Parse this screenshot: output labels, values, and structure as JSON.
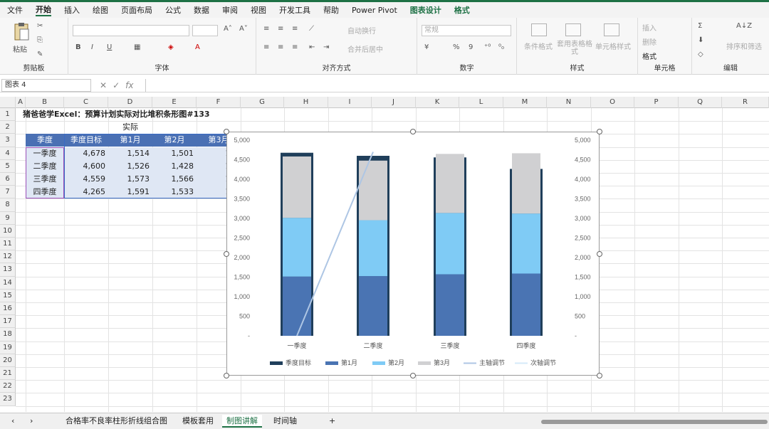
{
  "menu": [
    "文件",
    "开始",
    "插入",
    "绘图",
    "页面布局",
    "公式",
    "数据",
    "审阅",
    "视图",
    "开发工具",
    "帮助",
    "Power Pivot",
    "图表设计",
    "格式"
  ],
  "ribbon": {
    "paste": "粘贴",
    "clipboard": "剪贴板",
    "font": "字体",
    "alignment": "对齐方式",
    "number": "数字",
    "styles": "样式",
    "cells": "单元格",
    "editing": "编辑",
    "wrap": "自动换行",
    "merge": "合并后居中",
    "number_format": "常规",
    "cond_format": "条件格式",
    "table_format": "套用表格格式",
    "cell_styles": "单元格样式",
    "insert": "插入",
    "delete": "删除",
    "format": "格式",
    "sort_filter": "排序和筛选",
    "bold": "B",
    "italic": "I",
    "underline": "U",
    "percent": "%",
    "comma": "9"
  },
  "formula_bar": {
    "name_box": "图表 4",
    "fx": "fx"
  },
  "columns": [
    "A",
    "B",
    "C",
    "D",
    "E",
    "F",
    "G",
    "H",
    "I",
    "J",
    "K",
    "L",
    "M",
    "N",
    "O",
    "P",
    "Q",
    "R"
  ],
  "rows": [
    "1",
    "2",
    "3",
    "4",
    "5",
    "6",
    "7",
    "8",
    "9",
    "10",
    "11",
    "12",
    "13",
    "14",
    "15",
    "16",
    "17",
    "18",
    "19",
    "20",
    "21",
    "22",
    "23"
  ],
  "sheet": {
    "title": "猪爸爸学Excel：预算计划实际对比堆积条形图#133",
    "actual_label": "实际",
    "headers": [
      "季度",
      "季度目标",
      "第1月",
      "第2月",
      "第3月"
    ],
    "rows": [
      [
        "一季度",
        "4,678",
        "1,514",
        "1,501",
        "1,5"
      ],
      [
        "二季度",
        "4,600",
        "1,526",
        "1,428",
        "1,5"
      ],
      [
        "三季度",
        "4,559",
        "1,573",
        "1,566",
        "1,5"
      ],
      [
        "四季度",
        "4,265",
        "1,591",
        "1,533",
        "1,5"
      ]
    ]
  },
  "chart_data": {
    "type": "bar",
    "categories": [
      "一季度",
      "二季度",
      "三季度",
      "四季度"
    ],
    "ylim": [
      0,
      5000
    ],
    "y_ticks": [
      "5,000",
      "4,500",
      "4,000",
      "3,500",
      "3,000",
      "2,500",
      "2,000",
      "1,500",
      "1,000",
      "500",
      "-"
    ],
    "y2_ticks": [
      "5,000",
      "4,500",
      "4,000",
      "3,500",
      "3,000",
      "2,500",
      "2,000",
      "1,500",
      "1,000",
      "500",
      "-"
    ],
    "series": [
      {
        "name": "季度目标",
        "type": "bar",
        "color": "#203f5b",
        "values": [
          4678,
          4600,
          4559,
          4265
        ]
      },
      {
        "name": "第1月",
        "type": "stacked",
        "color": "#4a74b3",
        "values": [
          1514,
          1526,
          1573,
          1591
        ]
      },
      {
        "name": "第2月",
        "type": "stacked",
        "color": "#7fcbf5",
        "values": [
          1501,
          1428,
          1566,
          1533
        ]
      },
      {
        "name": "第3月",
        "type": "stacked",
        "color": "#d0d0d2",
        "values": [
          1568,
          1523,
          1510,
          1541
        ]
      },
      {
        "name": "主轴调节",
        "type": "line",
        "color": "#aec6e4",
        "values": [
          0,
          4700
        ]
      },
      {
        "name": "次轴调节",
        "type": "line",
        "color": "#d6eaf8",
        "values": []
      }
    ],
    "legend": "bottom",
    "grid": false
  },
  "sheet_tabs": [
    "合格率不良率柱形折线组合图",
    "模板套用",
    "制图讲解",
    "时间轴"
  ],
  "active_tab": "制图讲解",
  "add_sheet": "+"
}
